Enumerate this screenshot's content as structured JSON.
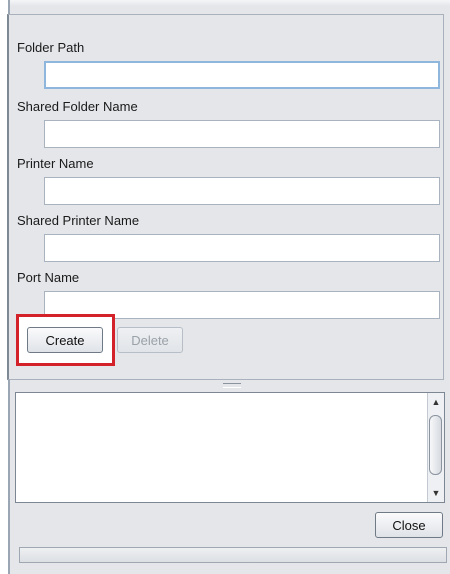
{
  "form": {
    "folder_path_label": "Folder Path",
    "folder_path_value": "",
    "shared_folder_name_label": "Shared Folder Name",
    "shared_folder_name_value": "",
    "printer_name_label": "Printer Name",
    "printer_name_value": "",
    "shared_printer_name_label": "Shared Printer Name",
    "shared_printer_name_value": "",
    "port_name_label": "Port Name",
    "port_name_value": ""
  },
  "actions": {
    "create_label": "Create",
    "delete_label": "Delete",
    "delete_enabled": false,
    "highlight_color": "#d3222a"
  },
  "output": {
    "text": "",
    "scroll_up_icon": "triangle-up",
    "scroll_down_icon": "triangle-down"
  },
  "footer": {
    "close_label": "Close"
  }
}
